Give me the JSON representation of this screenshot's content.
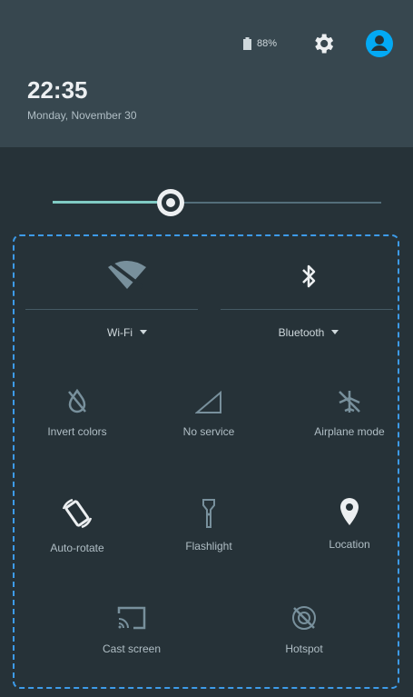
{
  "status": {
    "battery_text": "88%"
  },
  "header": {
    "time": "22:35",
    "date": "Monday, November 30"
  },
  "brightness": {
    "level": 0.36
  },
  "tiles_top": [
    {
      "label": "Wi-Fi",
      "icon": "wifi-off-icon"
    },
    {
      "label": "Bluetooth",
      "icon": "bluetooth-icon"
    }
  ],
  "tiles": [
    {
      "label": "Invert colors",
      "icon": "invert-colors-icon"
    },
    {
      "label": "No service",
      "icon": "signal-icon"
    },
    {
      "label": "Airplane mode",
      "icon": "airplane-icon"
    },
    {
      "label": "Auto-rotate",
      "icon": "rotate-icon"
    },
    {
      "label": "Flashlight",
      "icon": "flashlight-icon"
    },
    {
      "label": "Location",
      "icon": "location-icon"
    },
    {
      "label": "Cast screen",
      "icon": "cast-icon"
    },
    {
      "label": "Hotspot",
      "icon": "hotspot-icon"
    }
  ],
  "colors": {
    "accent": "#80cbc4",
    "panel_bg": "#263238",
    "header_bg": "#37474f",
    "highlight": "#3d9be9",
    "avatar": "#03a9f4"
  }
}
